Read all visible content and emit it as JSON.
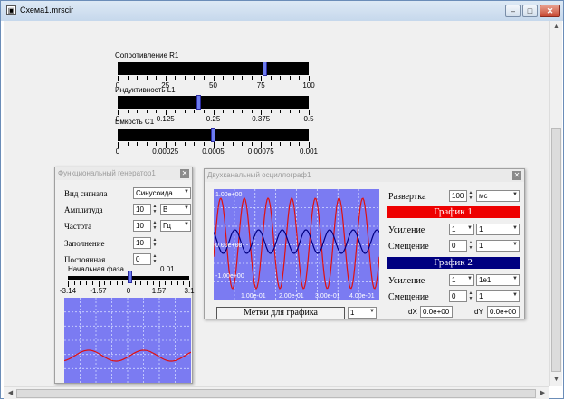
{
  "window": {
    "title": "Схема1.mrscir",
    "min": "–",
    "max": "□",
    "close": "✕"
  },
  "sliders": [
    {
      "label": "Сопротивление R1",
      "ticks": [
        "0",
        "25",
        "50",
        "75",
        "100"
      ],
      "value": 0.78
    },
    {
      "label": "Индуктивность L1",
      "ticks": [
        "0",
        "0.125",
        "0.25",
        "0.375",
        "0.5"
      ],
      "value": 0.42
    },
    {
      "label": "Емкость C1",
      "ticks": [
        "0",
        "0.00025",
        "0.0005",
        "0.00075",
        "0.001"
      ],
      "value": 0.5
    }
  ],
  "generator": {
    "title": "Функциональный генератор1",
    "signal_label": "Вид сигнала",
    "signal_value": "Синусоида",
    "amp_label": "Амплитуда",
    "amp_value": "10",
    "amp_unit": "В",
    "freq_label": "Частота",
    "freq_value": "10",
    "freq_unit": "Гц",
    "fill_label": "Заполнение",
    "fill_value": "10",
    "dc_label": "Постоянная",
    "dc_value": "0",
    "phase_label": "Начальная фаза",
    "phase_value": "0.01",
    "phase_ticks": [
      "-3.14",
      "-1.57",
      "0",
      "1.57",
      "3.1"
    ]
  },
  "scope": {
    "title": "Двухканальный осциллограф1",
    "sweep_label": "Развертка",
    "sweep_value": "100",
    "sweep_unit": "мс",
    "ch1_header": "График 1",
    "gain_label": "Усиление",
    "ch1_gain_a": "1",
    "ch1_gain_b": "1",
    "offset_label": "Смещение",
    "ch1_offset_a": "0",
    "ch1_offset_b": "1",
    "ch2_header": "График 2",
    "ch2_gain_a": "1",
    "ch2_gain_b": "1e1",
    "ch2_offset_a": "0",
    "ch2_offset_b": "1",
    "marks_button": "Метки для графика",
    "marks_value": "1",
    "dx_label": "dX",
    "dx_value": "0.0e+00",
    "dy_label": "dY",
    "dy_value": "0.0e+00",
    "y_labels": [
      "1.00e+00",
      "0.00e+00",
      "-1.00e+00"
    ],
    "x_labels": [
      "1.00e-01",
      "2.00e-01",
      "3.00e-01",
      "4.00e-01"
    ]
  },
  "colors": {
    "plot_bg": "#7b7bf2",
    "trace1": "#e01010",
    "trace2": "#000080",
    "ch1": "#ee0000",
    "ch2": "#000080"
  }
}
